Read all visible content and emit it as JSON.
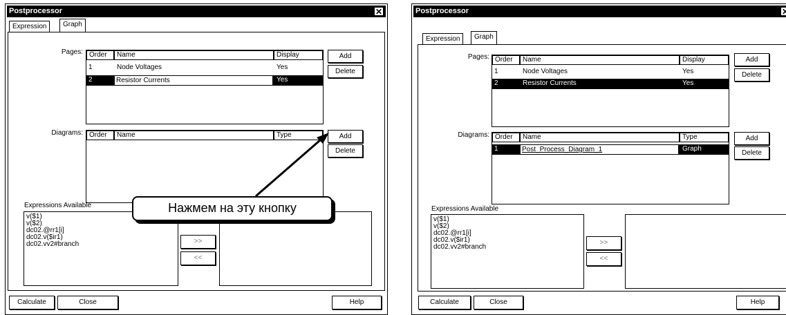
{
  "left": {
    "title": "Postprocessor",
    "tabs": [
      "Expression",
      "Graph"
    ],
    "pages_label": "Pages:",
    "pages_headers": {
      "order": "Order",
      "name": "Name",
      "display": "Display"
    },
    "pages_rows": [
      {
        "order": "1",
        "name": "Node Voltages",
        "display": "Yes"
      },
      {
        "order": "2",
        "name": "Resistor Currents",
        "display": "Yes"
      }
    ],
    "add_label": "Add",
    "delete_label": "Delete",
    "diagrams_label": "Diagrams:",
    "diagrams_headers": {
      "order": "Order",
      "name": "Name",
      "type": "Type"
    },
    "expressions_label": "Expressions Available",
    "expressions": [
      "v($1)",
      "v($2)",
      "dc02.@rr1[i]",
      "dc02.v($ir1)",
      "dc02.vv2#branch"
    ],
    "move_right": ">>",
    "move_left": "<<",
    "calculate_label": "Calculate",
    "close_label": "Close",
    "help_label": "Help",
    "callout_text": "Нажмем на эту кнопку"
  },
  "right": {
    "title": "Postprocessor",
    "tabs": [
      "Expression",
      "Graph"
    ],
    "pages_label": "Pages:",
    "pages_headers": {
      "order": "Order",
      "name": "Name",
      "display": "Display"
    },
    "pages_rows": [
      {
        "order": "1",
        "name": "Node Voltages",
        "display": "Yes"
      },
      {
        "order": "2",
        "name": "Resistor Currents",
        "display": "Yes"
      }
    ],
    "add_label": "Add",
    "delete_label": "Delete",
    "diagrams_label": "Diagrams:",
    "diagrams_headers": {
      "order": "Order",
      "name": "Name",
      "type": "Type"
    },
    "diagrams_rows": [
      {
        "order": "1",
        "name": "Post_Process_Diagram_1",
        "type": "Graph"
      }
    ],
    "expressions_label": "Expressions Available",
    "expressions": [
      "v($1)",
      "v($2)",
      "dc02.@rr1[i]",
      "dc02.v($ir1)",
      "dc02.vv2#branch"
    ],
    "move_right": ">>",
    "move_left": "<<",
    "calculate_label": "Calculate",
    "close_label": "Close",
    "help_label": "Help"
  }
}
